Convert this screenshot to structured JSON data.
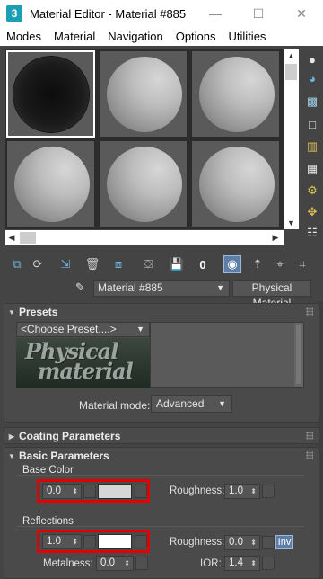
{
  "window": {
    "title": "Material Editor - Material #885",
    "app_icon": "3",
    "minimize": "—",
    "maximize": "☐",
    "close": "✕"
  },
  "menu": [
    "Modes",
    "Material",
    "Navigation",
    "Options",
    "Utilities"
  ],
  "material_name": "Material #885",
  "material_type": "Physical Material",
  "presets": {
    "title": "Presets",
    "choose": "<Choose Preset....>",
    "logo_line1": "Physical",
    "logo_line2": "material",
    "mode_label": "Material mode:",
    "mode_value": "Advanced"
  },
  "coating": {
    "title": "Coating Parameters"
  },
  "basic": {
    "title": "Basic Parameters",
    "base_color": {
      "label": "Base Color",
      "weight": "0.0",
      "swatch_color": "#d6d6d6",
      "roughness_label": "Roughness:",
      "roughness": "1.0"
    },
    "reflections": {
      "label": "Reflections",
      "weight": "1.0",
      "swatch_color": "#ffffff",
      "roughness_label": "Roughness:",
      "roughness": "0.0",
      "inv_label": "Inv",
      "metalness_label": "Metalness:",
      "metalness": "0.0",
      "ior_label": "IOR:",
      "ior": "1.4"
    }
  },
  "colors": {
    "highlight": "#e20000",
    "active_blue": "#5f7ea7",
    "panel_bg": "#4a4a4a"
  }
}
